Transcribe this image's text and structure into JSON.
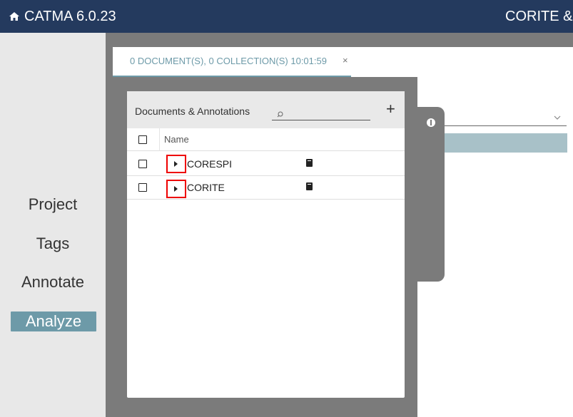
{
  "header": {
    "app_title": "CATMA 6.0.23",
    "project_name": "CORITE &"
  },
  "nav": {
    "items": [
      "Project",
      "Tags",
      "Annotate",
      "Analyze"
    ],
    "active": "Analyze"
  },
  "tab": {
    "label": "0 DOCUMENT(S), 0 COLLECTION(S) 10:01:59",
    "close": "×"
  },
  "documents_panel": {
    "title": "Documents & Annotations",
    "add": "+",
    "column_name": "Name",
    "rows": [
      {
        "name": "CORESPI"
      },
      {
        "name": "CORITE"
      }
    ]
  },
  "icons": {
    "home": "home-icon",
    "search": "search-icon",
    "info": "info-icon",
    "document": "document-icon",
    "expand": "caret-right-icon",
    "dropdown": "chevron-down-icon"
  },
  "colors": {
    "header_bg": "#243a5e",
    "accent": "#6d9aa8",
    "highlight": "#e00000"
  }
}
